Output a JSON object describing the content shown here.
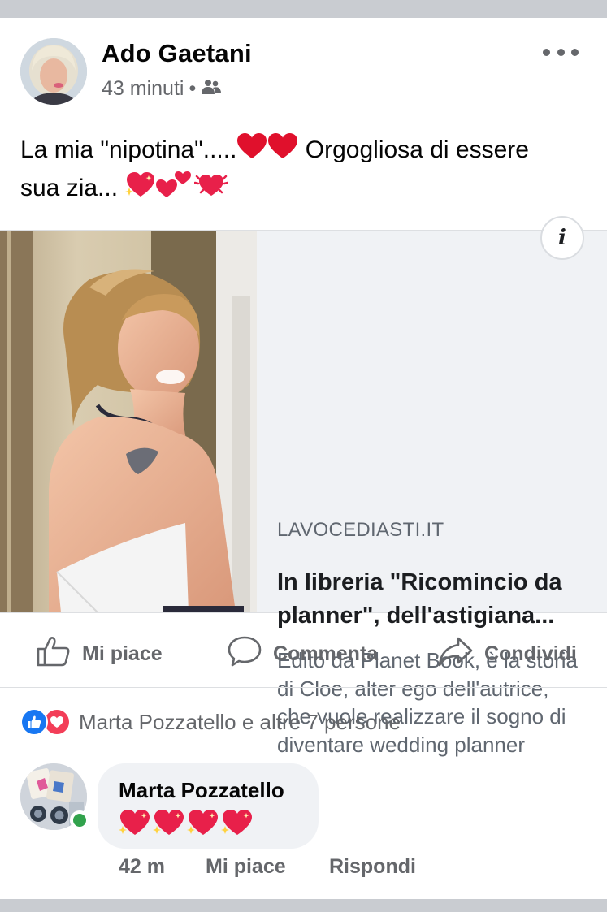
{
  "post": {
    "author": "Ado Gaetani",
    "time": "43 minuti",
    "separator": "•",
    "audience_icon": "friends-icon",
    "text_line1": "La mia \"nipotina\".....",
    "text_line1_after": " Orgogliosa di essere",
    "text_line2": "sua zia... "
  },
  "link_preview": {
    "domain": "LAVOCEDIASTI.IT",
    "title": "In libreria \"Ricomincio da planner\", dell'astigiana...",
    "description": "Edito da Planet Book, è la storia di Cloe, alter ego dell'autrice, che vuole realizzare il sogno di diventare wedding planner",
    "info_label": "i"
  },
  "actions": {
    "like": "Mi piace",
    "comment": "Commenta",
    "share": "Condividi"
  },
  "reactions": {
    "summary": "Marta Pozzatello e altre 7 persone",
    "types": [
      "like",
      "love"
    ]
  },
  "comment": {
    "author": "Marta Pozzatello",
    "time": "42 m",
    "like_label": "Mi piace",
    "reply_label": "Rispondi"
  },
  "colors": {
    "like_blue": "#1877f2",
    "love_red": "#f33e58",
    "heart_red": "#e0102c",
    "online_green": "#31a24c",
    "secondary_text": "#65676b"
  }
}
